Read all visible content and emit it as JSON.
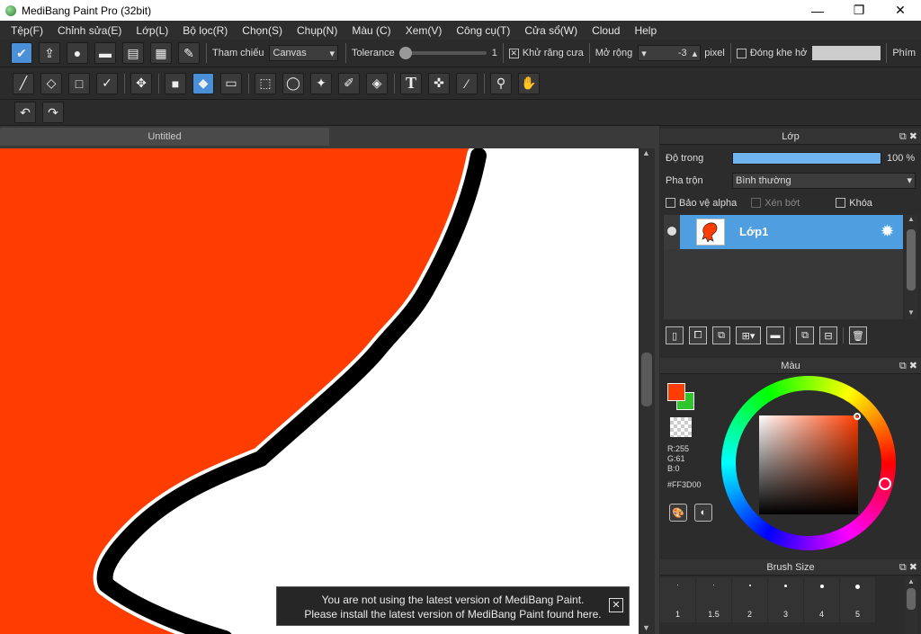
{
  "title": "MediBang Paint Pro (32bit)",
  "window_controls": {
    "minimize": "—",
    "maximize": "❐",
    "close": "✕"
  },
  "menu": [
    "Tệp(F)",
    "Chỉnh sửa(E)",
    "Lớp(L)",
    "Bộ lọc(R)",
    "Chọn(S)",
    "Chụp(N)",
    "Màu (C)",
    "Xem(V)",
    "Công cụ(T)",
    "Cửa sổ(W)",
    "Cloud",
    "Help"
  ],
  "toolbar_options": {
    "reference_label": "Tham chiếu",
    "reference_value": "Canvas",
    "tolerance_label": "Tolerance",
    "tolerance_value": "1",
    "antialias_label": "Khử răng cưa",
    "expand_label": "Mở rộng",
    "expand_value": "-3",
    "expand_unit": "pixel",
    "close_gap_label": "Đóng khe hở",
    "key_label": "Phím"
  },
  "document_tab": "Untitled",
  "notice": {
    "line1": "You are not using the latest version of MediBang Paint.",
    "line2": "Please install the latest version of MediBang Paint found here."
  },
  "layer_panel": {
    "title": "Lớp",
    "opacity_label": "Độ trong",
    "opacity_value": "100 %",
    "blend_label": "Pha trộn",
    "blend_value": "Bình thường",
    "protect_alpha": "Bảo vệ alpha",
    "clipping": "Xén bớt",
    "lock": "Khóa",
    "layer_name": "Lớp1",
    "opacity_fraction": 1.0
  },
  "color_panel": {
    "title": "Màu",
    "r": "R:255",
    "g": "G:61",
    "b": "B:0",
    "hex": "#FF3D00",
    "fg_color": "#FF3D00",
    "bg_color": "#2EC52E"
  },
  "brush_panel": {
    "title": "Brush Size",
    "sizes": [
      "1",
      "1.5",
      "2",
      "3",
      "4",
      "5"
    ]
  },
  "panel_controls": "⧉ ✖"
}
